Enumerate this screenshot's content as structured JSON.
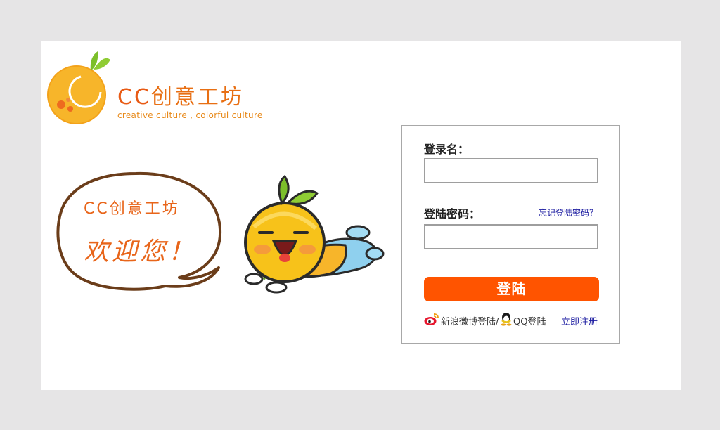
{
  "logo": {
    "title_cc": "CC",
    "title_rest": "创意工坊",
    "subtitle": "creative  culture , colorful culture"
  },
  "illustration": {
    "bubble_line1": "CC创意工坊",
    "bubble_line2": "欢迎您！"
  },
  "login": {
    "username_label": "登录名：",
    "username_value": "",
    "password_label": "登陆密码：",
    "password_value": "",
    "forgot_link": "忘记登陆密码？",
    "submit_label": "登陆",
    "weibo_label": "新浪微博登陆/",
    "qq_label": "QQ登陆",
    "register_link": "立即注册"
  },
  "colors": {
    "background": "#e6e5e6",
    "accent": "#ff5400",
    "link": "#1a1aa0",
    "brand_orange": "#e86f13"
  },
  "icons": [
    "orange-logo-icon",
    "weibo-icon",
    "qq-icon"
  ]
}
